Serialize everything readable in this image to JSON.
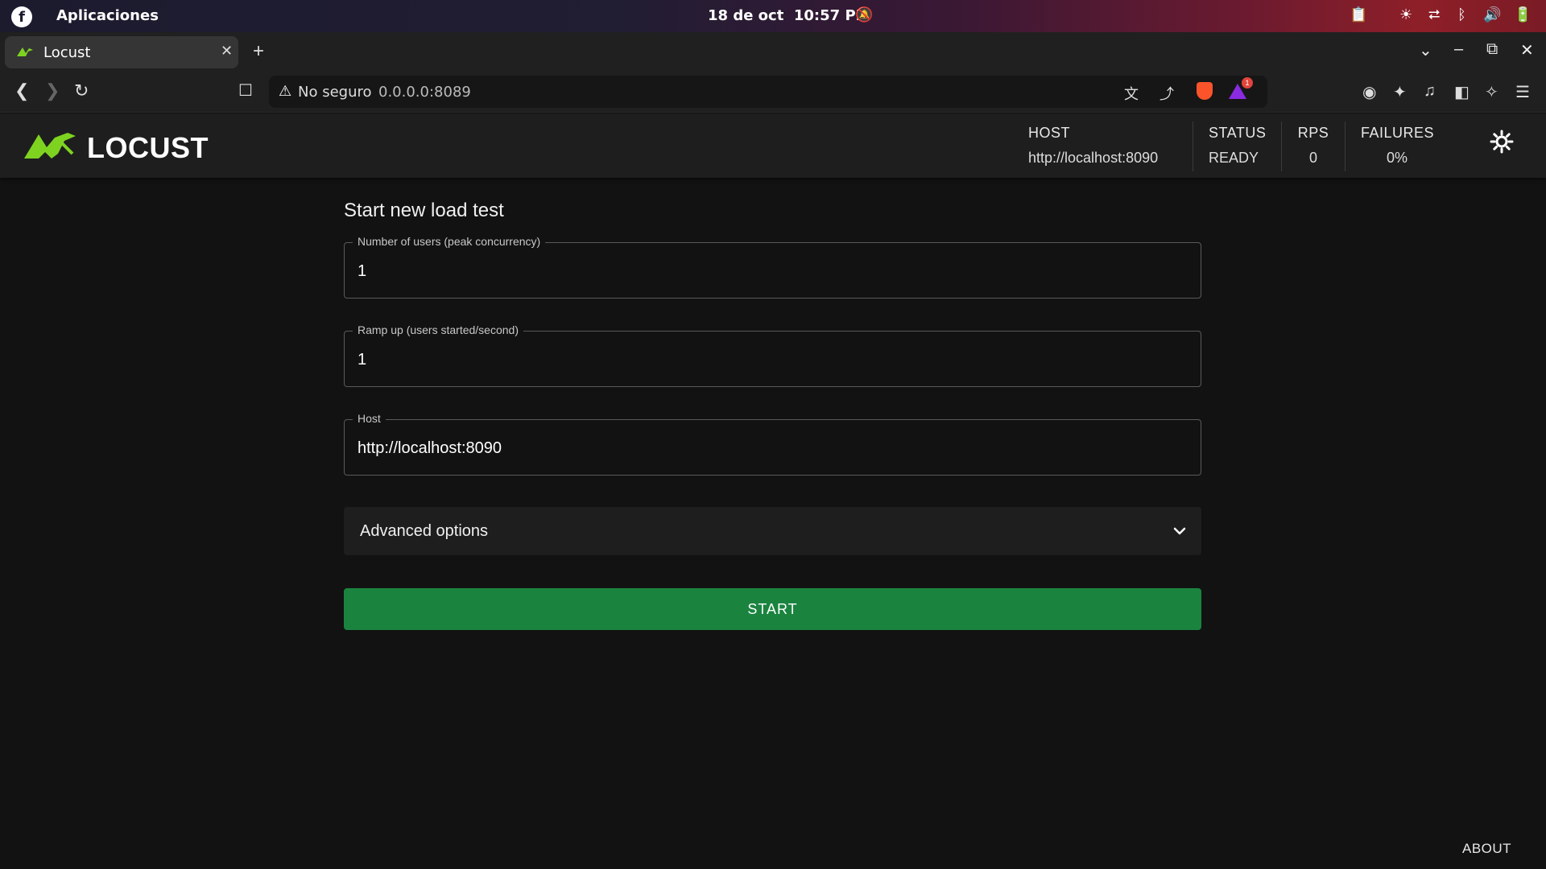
{
  "system_bar": {
    "apps_label": "Aplicaciones",
    "date": "18 de oct",
    "time": "10:57 PM"
  },
  "browser": {
    "tab_title": "Locust",
    "security_label": "No seguro",
    "url": "0.0.0.0:8089",
    "notification_count": "1"
  },
  "header": {
    "logo_text": "LOCUST",
    "stats": [
      {
        "label": "HOST",
        "value": "http://localhost:8090"
      },
      {
        "label": "STATUS",
        "value": "READY"
      },
      {
        "label": "RPS",
        "value": "0"
      },
      {
        "label": "FAILURES",
        "value": "0%"
      }
    ]
  },
  "form": {
    "title": "Start new load test",
    "users": {
      "label": "Number of users (peak concurrency)",
      "value": "1"
    },
    "ramp_up": {
      "label": "Ramp up (users started/second)",
      "value": "1"
    },
    "host": {
      "label": "Host",
      "value": "http://localhost:8090"
    },
    "advanced_label": "Advanced options",
    "start_label": "START"
  },
  "footer": {
    "about_label": "ABOUT"
  },
  "colors": {
    "accent_green": "#1a843f",
    "logo_green": "#7ed321",
    "background": "#121212"
  }
}
